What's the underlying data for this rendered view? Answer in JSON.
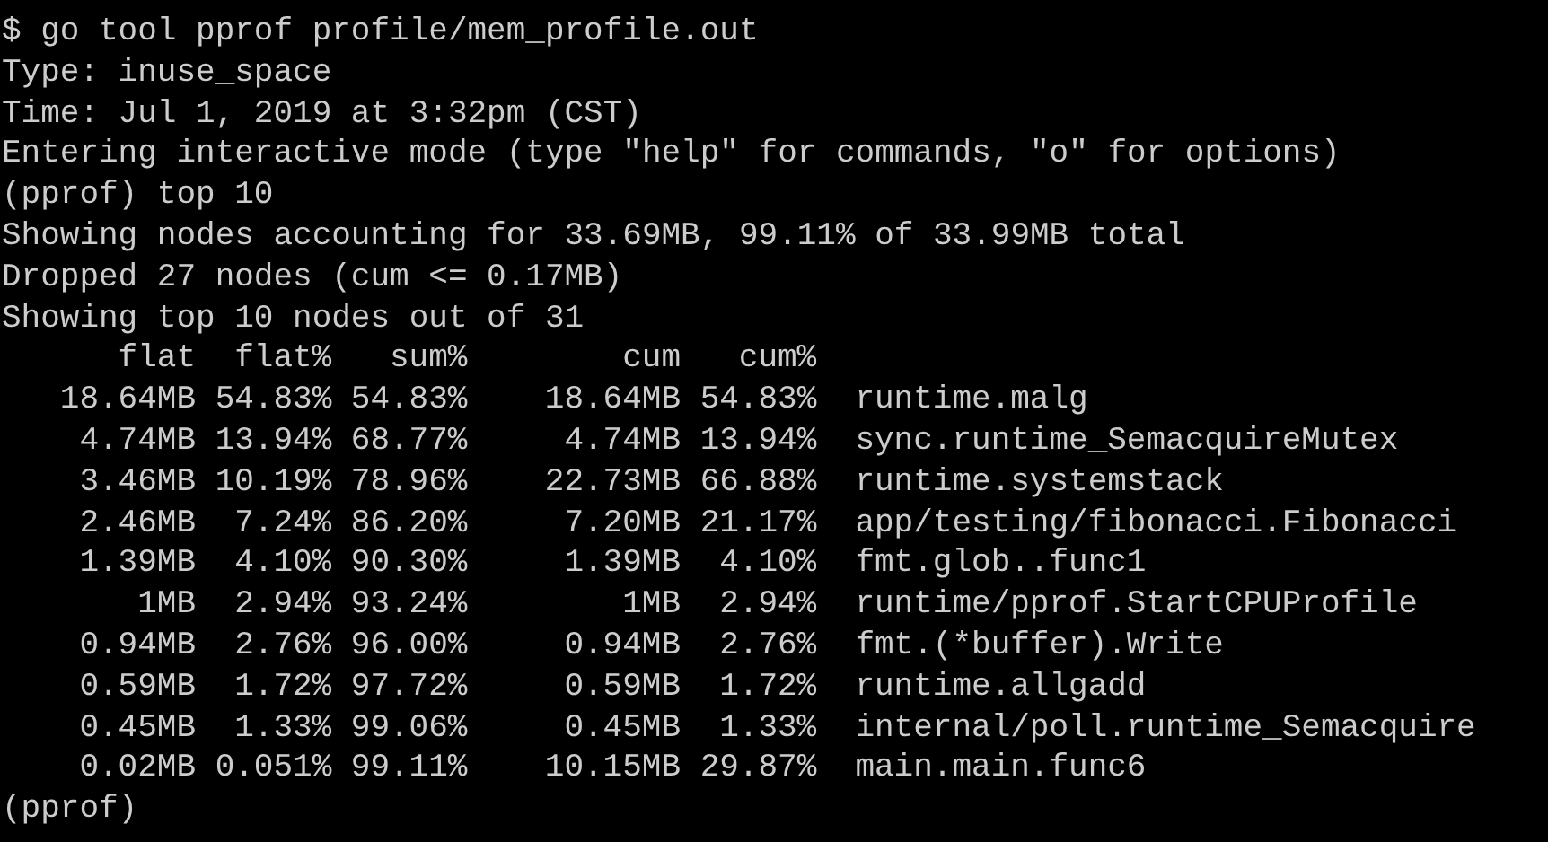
{
  "lines_before": [
    "$ go tool pprof profile/mem_profile.out",
    "Type: inuse_space",
    "Time: Jul 1, 2019 at 3:32pm (CST)",
    "Entering interactive mode (type \"help\" for commands, \"o\" for options)",
    "(pprof) top 10",
    "Showing nodes accounting for 33.69MB, 99.11% of 33.99MB total",
    "Dropped 27 nodes (cum <= 0.17MB)",
    "Showing top 10 nodes out of 31"
  ],
  "table": {
    "columns": [
      "flat",
      "flat%",
      "sum%",
      "cum",
      "cum%"
    ],
    "rows": [
      [
        "18.64MB",
        "54.83%",
        "54.83%",
        "18.64MB",
        "54.83%",
        "runtime.malg"
      ],
      [
        "4.74MB",
        "13.94%",
        "68.77%",
        "4.74MB",
        "13.94%",
        "sync.runtime_SemacquireMutex"
      ],
      [
        "3.46MB",
        "10.19%",
        "78.96%",
        "22.73MB",
        "66.88%",
        "runtime.systemstack"
      ],
      [
        "2.46MB",
        "7.24%",
        "86.20%",
        "7.20MB",
        "21.17%",
        "app/testing/fibonacci.Fibonacci"
      ],
      [
        "1.39MB",
        "4.10%",
        "90.30%",
        "1.39MB",
        "4.10%",
        "fmt.glob..func1"
      ],
      [
        "1MB",
        "2.94%",
        "93.24%",
        "1MB",
        "2.94%",
        "runtime/pprof.StartCPUProfile"
      ],
      [
        "0.94MB",
        "2.76%",
        "96.00%",
        "0.94MB",
        "2.76%",
        "fmt.(*buffer).Write"
      ],
      [
        "0.59MB",
        "1.72%",
        "97.72%",
        "0.59MB",
        "1.72%",
        "runtime.allgadd"
      ],
      [
        "0.45MB",
        "1.33%",
        "99.06%",
        "0.45MB",
        "1.33%",
        "internal/poll.runtime_Semacquire"
      ],
      [
        "0.02MB",
        "0.051%",
        "99.11%",
        "10.15MB",
        "29.87%",
        "main.main.func6"
      ]
    ]
  },
  "prompt": "(pprof)"
}
